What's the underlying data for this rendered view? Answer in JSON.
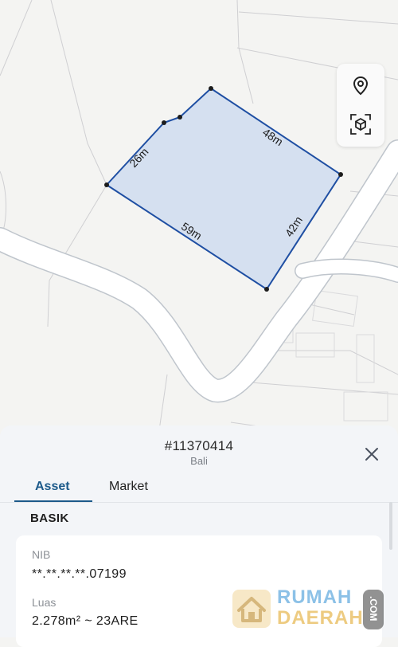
{
  "map": {
    "edge_labels": {
      "north_west": "26m",
      "north_east": "48m",
      "south_west": "59m",
      "south_east": "42m"
    },
    "parcel_fill": "#d5e0f0",
    "parcel_stroke": "#1f4fa3"
  },
  "controls": {
    "pin_icon": "map-pin-icon",
    "cube_icon": "3d-cube-icon"
  },
  "sheet": {
    "parcel_id": "#11370414",
    "region": "Bali",
    "tabs": [
      {
        "label": "Asset",
        "active": true
      },
      {
        "label": "Market",
        "active": false
      }
    ],
    "section_title": "BASIK",
    "fields": [
      {
        "label": "NIB",
        "value": "**.**.**.**.07199"
      },
      {
        "label": "Luas",
        "value": "2.278m² ~ 23ARE"
      }
    ]
  },
  "watermark": {
    "line1": "RUMAH",
    "line2": "DAERAH",
    "suffix": ".COM"
  },
  "colors": {
    "accent": "#1c5a8a",
    "watermark_blue": "#2f8fd4",
    "watermark_gold": "#e0a21b"
  }
}
